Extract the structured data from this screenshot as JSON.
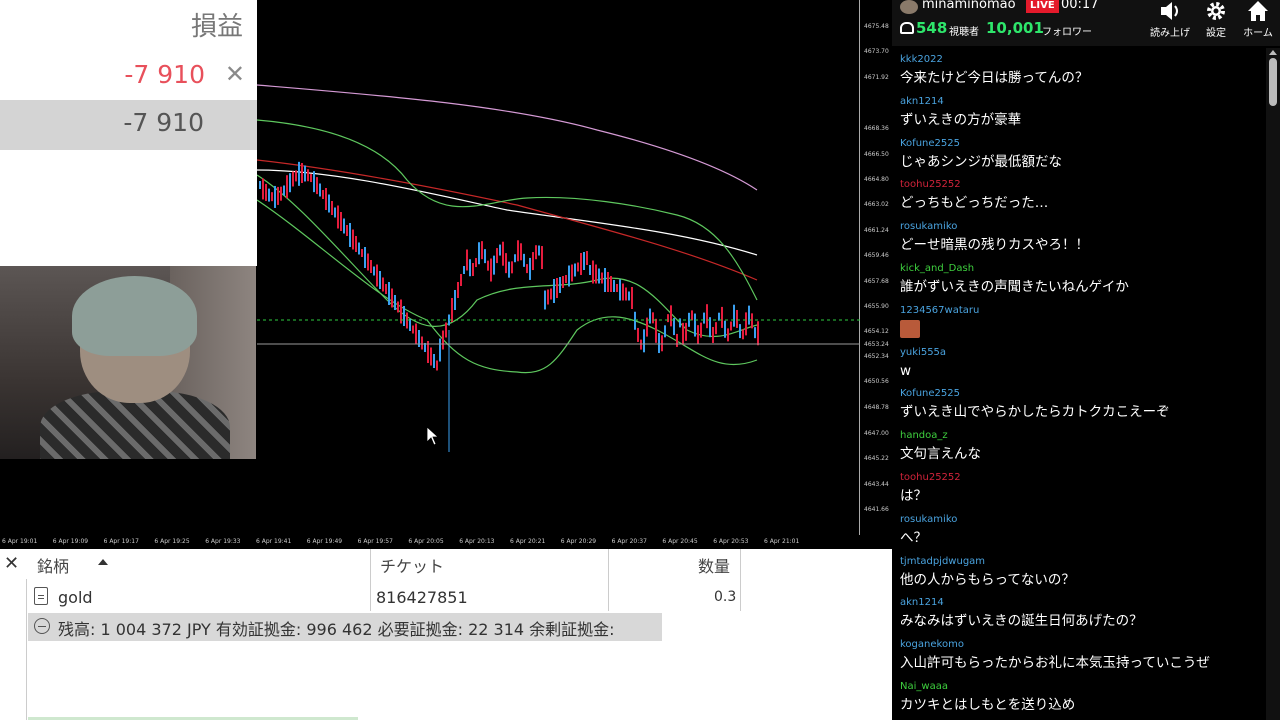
{
  "pl_panel": {
    "header": "損益",
    "position_pl": "-7 910",
    "close_glyph": "✕",
    "total_pl": "-7 910"
  },
  "price_axis": [
    "4675.48",
    "4673.70",
    "4671.92",
    "4668.36",
    "4666.50",
    "4664.80",
    "4663.02",
    "4661.24",
    "4659.46",
    "4657.68",
    "4655.90",
    "4654.12",
    "4653.24",
    "4652.34",
    "4650.56",
    "4648.78",
    "4647.00",
    "4645.22",
    "4643.44",
    "4641.66"
  ],
  "time_axis": [
    "6 Apr 19:01",
    "6 Apr 19:09",
    "6 Apr 19:17",
    "6 Apr 19:25",
    "6 Apr 19:33",
    "6 Apr 19:41",
    "6 Apr 19:49",
    "6 Apr 19:57",
    "6 Apr 20:05",
    "6 Apr 20:13",
    "6 Apr 20:21",
    "6 Apr 20:29",
    "6 Apr 20:37",
    "6 Apr 20:45",
    "6 Apr 20:53",
    "6 Apr 21:01"
  ],
  "table": {
    "close_glyph": "✕",
    "col_symbol": "銘柄",
    "col_ticket": "チケット",
    "col_volume": "数量",
    "row": {
      "symbol": "gold",
      "ticket": "816427851",
      "volume": "0.3"
    },
    "balance_line": "残高: 1 004 372 JPY  有効証拠金: 996 462  必要証拠金: 22 314  余剰証拠金:"
  },
  "stream": {
    "streamer": "minaminomao",
    "live": "LIVE",
    "time": "00:17",
    "viewers": "548",
    "viewers_label": "視聴者",
    "followers": "10,001",
    "followers_label": "フォロワー",
    "btn_read": "読み上げ",
    "btn_settings": "設定",
    "btn_home": "ホーム"
  },
  "chat": [
    {
      "user": "kkk2022",
      "color": "#4aa3df",
      "text": "今来たけど今日は勝ってんの？"
    },
    {
      "user": "akn1214",
      "color": "#4aa3df",
      "text": "ずいえきの方が豪華"
    },
    {
      "user": "Kofune2525",
      "color": "#4aa3df",
      "text": "じゃあシンジが最低額だな"
    },
    {
      "user": "toohu25252",
      "color": "#d0233a",
      "text": "どっちもどっちだった…"
    },
    {
      "user": "rosukamiko",
      "color": "#4aa3df",
      "text": "どーせ暗黒の残りカスやろ！！"
    },
    {
      "user": "kick_and_Dash",
      "color": "#3ecf3e",
      "text": "誰がずいえきの声聞きたいねんゲイか"
    },
    {
      "user": "1234567wataru",
      "color": "#4aa3df",
      "text": ""
    },
    {
      "user": "yuki555a",
      "color": "#4aa3df",
      "text": "w"
    },
    {
      "user": "Kofune2525",
      "color": "#4aa3df",
      "text": "ずいえき山でやらかしたらカトクカこえーぞ"
    },
    {
      "user": "handoa_z",
      "color": "#3ecf3e",
      "text": "文句言えんな"
    },
    {
      "user": "toohu25252",
      "color": "#d0233a",
      "text": "は？"
    },
    {
      "user": "rosukamiko",
      "color": "#4aa3df",
      "text": "へ？"
    },
    {
      "user": "tjmtadpjdwugam",
      "color": "#4aa3df",
      "text": "他の人からもらってないの？"
    },
    {
      "user": "akn1214",
      "color": "#4aa3df",
      "text": "みなみはずいえきの誕生日何あげたの？"
    },
    {
      "user": "koganekomo",
      "color": "#4aa3df",
      "text": "入山許可もらったからお礼に本気玉持っていこうぜ"
    },
    {
      "user": "Nai_waaa",
      "color": "#3ecf3e",
      "text": "カツキとはしもとを送り込め"
    }
  ]
}
